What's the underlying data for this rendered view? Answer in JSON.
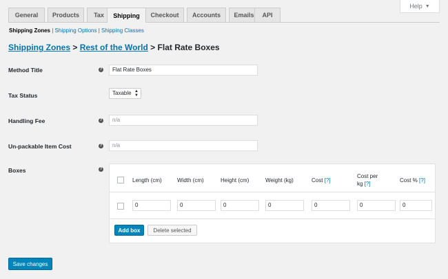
{
  "help": {
    "label": "Help",
    "caret": "▼"
  },
  "tabs": [
    {
      "label": "General"
    },
    {
      "label": "Products"
    },
    {
      "label": "Tax"
    },
    {
      "label": "Shipping",
      "active": true
    },
    {
      "label": "Checkout"
    },
    {
      "label": "Accounts"
    },
    {
      "label": "Emails"
    },
    {
      "label": "API"
    }
  ],
  "subnav": {
    "zones": "Shipping Zones",
    "separator": "|",
    "options": "Shipping Options",
    "classes": "Shipping Classes"
  },
  "breadcrumb": {
    "zones": "Shipping Zones",
    "sep1": ">",
    "rest": "Rest of the World",
    "sep2": ">",
    "current": "Flat Rate Boxes"
  },
  "fields": {
    "method_title": {
      "label": "Method Title",
      "value": "Flat Rate Boxes"
    },
    "tax_status": {
      "label": "Tax Status",
      "value": "Taxable"
    },
    "handling_fee": {
      "label": "Handling Fee",
      "placeholder": "n/a"
    },
    "unpackable_cost": {
      "label": "Un-packable Item Cost",
      "placeholder": "n/a"
    },
    "boxes": {
      "label": "Boxes"
    }
  },
  "help_icon": "?",
  "boxes_table": {
    "headers": {
      "length": "Length (cm)",
      "width": "Width (cm)",
      "height": "Height (cm)",
      "weight": "Weight (kg)",
      "cost": "Cost",
      "cost_per_kg_line1": "Cost per",
      "cost_per_kg_line2": "kg",
      "cost_pct": "Cost %",
      "help_link": "[?]"
    },
    "row": [
      "0",
      "0",
      "0",
      "0",
      "0",
      "0",
      "0"
    ],
    "add_box": "Add box",
    "delete_selected": "Delete selected"
  },
  "save_changes": "Save changes"
}
